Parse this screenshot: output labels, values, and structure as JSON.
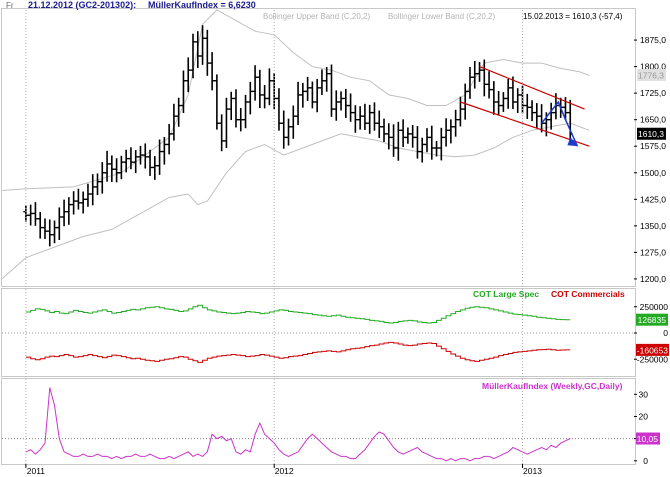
{
  "header": {
    "prefix": "Fr",
    "date_symbol": "21.12.2012 (GC2-201302):",
    "indicator": "MüllerKaufIndex = 6,6230",
    "band_upper": "Bollinger Upper Band (C,20,2)",
    "band_lower": "Bollinger Lower Band (C,20,2)",
    "last_quote": "15.02.2013 = 1610,3 (-57,4)"
  },
  "colors": {
    "bars": "#000000",
    "bands": "#c0c0c0",
    "channel": "#cc0000",
    "arrow": "#1a3ccc",
    "cot_large": "#22aa22",
    "cot_comm": "#cc0000",
    "kauf": "#cc33cc"
  },
  "chart_data": [
    {
      "type": "ohlc",
      "y_ticks": [
        "1875,0",
        "1800,0",
        "1725,0",
        "1650,0",
        "1575,0",
        "1500,0",
        "1425,0",
        "1350,0",
        "1275,0",
        "1200,0"
      ],
      "y_tick_values": [
        1875,
        1800,
        1725,
        1650,
        1575,
        1500,
        1425,
        1350,
        1275,
        1200
      ],
      "ylim": [
        1180,
        1960
      ],
      "price_labels": [
        {
          "text": "1776,3",
          "value": 1776.3
        },
        {
          "text": "1610,3",
          "value": 1610.3
        }
      ],
      "x_ticks": [
        "2011",
        "2012",
        "2013"
      ],
      "x_tick_weeks": [
        0,
        52,
        104
      ],
      "week_range": [
        -5,
        124
      ],
      "closes": [
        1380,
        1385,
        1370,
        1345,
        1335,
        1325,
        1345,
        1375,
        1390,
        1410,
        1420,
        1415,
        1425,
        1440,
        1460,
        1475,
        1500,
        1525,
        1510,
        1500,
        1530,
        1540,
        1530,
        1545,
        1550,
        1545,
        1515,
        1520,
        1560,
        1580,
        1610,
        1660,
        1690,
        1760,
        1790,
        1870,
        1830,
        1880,
        1810,
        1760,
        1640,
        1590,
        1680,
        1710,
        1650,
        1650,
        1700,
        1730,
        1770,
        1720,
        1710,
        1760,
        1710,
        1640,
        1600,
        1630,
        1660,
        1720,
        1730,
        1740,
        1700,
        1740,
        1760,
        1780,
        1680,
        1700,
        1710,
        1690,
        1670,
        1650,
        1660,
        1640,
        1670,
        1640,
        1630,
        1610,
        1600,
        1570,
        1620,
        1600,
        1610,
        1600,
        1560,
        1580,
        1600,
        1570,
        1570,
        1600,
        1620,
        1630,
        1650,
        1680,
        1730,
        1770,
        1780,
        1790,
        1750,
        1735,
        1700,
        1690,
        1710,
        1740,
        1700,
        1720,
        1690,
        1685,
        1670,
        1660,
        1640,
        1650,
        1670,
        1690,
        1685,
        1670,
        1610
      ],
      "upper_band": [
        [
          -5,
          1450
        ],
        [
          0,
          1455
        ],
        [
          10,
          1460
        ],
        [
          20,
          1500
        ],
        [
          26,
          1560
        ],
        [
          30,
          1600
        ],
        [
          34,
          1720
        ],
        [
          37,
          1920
        ],
        [
          40,
          1960
        ],
        [
          44,
          1930
        ],
        [
          48,
          1900
        ],
        [
          52,
          1890
        ],
        [
          56,
          1840
        ],
        [
          60,
          1800
        ],
        [
          64,
          1790
        ],
        [
          68,
          1770
        ],
        [
          72,
          1760
        ],
        [
          76,
          1720
        ],
        [
          80,
          1710
        ],
        [
          84,
          1690
        ],
        [
          88,
          1690
        ],
        [
          92,
          1720
        ],
        [
          96,
          1810
        ],
        [
          100,
          1820
        ],
        [
          104,
          1810
        ],
        [
          108,
          1810
        ],
        [
          112,
          1795
        ],
        [
          116,
          1785
        ],
        [
          118,
          1775
        ]
      ],
      "lower_band": [
        [
          -5,
          1200
        ],
        [
          0,
          1260
        ],
        [
          6,
          1290
        ],
        [
          12,
          1320
        ],
        [
          18,
          1340
        ],
        [
          22,
          1370
        ],
        [
          26,
          1400
        ],
        [
          30,
          1430
        ],
        [
          34,
          1440
        ],
        [
          36,
          1410
        ],
        [
          38,
          1420
        ],
        [
          42,
          1500
        ],
        [
          46,
          1560
        ],
        [
          50,
          1580
        ],
        [
          54,
          1550
        ],
        [
          58,
          1570
        ],
        [
          62,
          1590
        ],
        [
          66,
          1610
        ],
        [
          70,
          1600
        ],
        [
          74,
          1590
        ],
        [
          78,
          1570
        ],
        [
          82,
          1560
        ],
        [
          86,
          1550
        ],
        [
          90,
          1545
        ],
        [
          94,
          1550
        ],
        [
          98,
          1570
        ],
        [
          102,
          1600
        ],
        [
          106,
          1620
        ],
        [
          110,
          1630
        ],
        [
          114,
          1640
        ],
        [
          118,
          1620
        ]
      ],
      "channel_upper": [
        [
          95,
          1800
        ],
        [
          117,
          1680
        ]
      ],
      "channel_lower": [
        [
          91,
          1700
        ],
        [
          118,
          1575
        ]
      ]
    },
    {
      "type": "line",
      "legend": [
        "COT Large Spec",
        "COT Commercials"
      ],
      "y_ticks": [
        "250000",
        "0",
        "-250000"
      ],
      "y_tick_values": [
        250000,
        0,
        -250000
      ],
      "ylim": [
        -400000,
        400000
      ],
      "value_labels": [
        "126835",
        "-160653"
      ],
      "series": [
        {
          "name": "COT Large Spec",
          "values": [
            200000,
            215000,
            230000,
            225000,
            210000,
            195000,
            205000,
            190000,
            185000,
            200000,
            215000,
            205000,
            195000,
            190000,
            200000,
            210000,
            220000,
            205000,
            190000,
            195000,
            205000,
            215000,
            225000,
            220000,
            230000,
            240000,
            245000,
            250000,
            240000,
            230000,
            225000,
            215000,
            205000,
            210000,
            230000,
            250000,
            265000,
            240000,
            220000,
            210000,
            200000,
            195000,
            190000,
            185000,
            190000,
            195000,
            205000,
            200000,
            195000,
            185000,
            190000,
            200000,
            210000,
            220000,
            215000,
            205000,
            200000,
            195000,
            190000,
            185000,
            175000,
            170000,
            165000,
            160000,
            165000,
            170000,
            160000,
            150000,
            145000,
            140000,
            135000,
            130000,
            120000,
            115000,
            110000,
            100000,
            95000,
            100000,
            110000,
            115000,
            120000,
            115000,
            105000,
            100000,
            95000,
            100000,
            120000,
            140000,
            165000,
            185000,
            205000,
            220000,
            235000,
            245000,
            250000,
            245000,
            240000,
            230000,
            220000,
            210000,
            200000,
            190000,
            180000,
            175000,
            170000,
            165000,
            160000,
            150000,
            145000,
            140000,
            135000,
            130000,
            128000,
            127000,
            126835
          ]
        },
        {
          "name": "COT Commercials",
          "values": [
            -230000,
            -245000,
            -255000,
            -245000,
            -230000,
            -220000,
            -225000,
            -215000,
            -205000,
            -215000,
            -230000,
            -225000,
            -215000,
            -205000,
            -215000,
            -225000,
            -235000,
            -225000,
            -210000,
            -215000,
            -225000,
            -235000,
            -245000,
            -240000,
            -250000,
            -260000,
            -265000,
            -270000,
            -260000,
            -250000,
            -245000,
            -235000,
            -225000,
            -230000,
            -250000,
            -265000,
            -280000,
            -260000,
            -240000,
            -230000,
            -220000,
            -215000,
            -210000,
            -205000,
            -210000,
            -215000,
            -225000,
            -220000,
            -215000,
            -205000,
            -210000,
            -220000,
            -230000,
            -240000,
            -235000,
            -225000,
            -220000,
            -215000,
            -205000,
            -195000,
            -185000,
            -180000,
            -175000,
            -170000,
            -175000,
            -180000,
            -170000,
            -160000,
            -150000,
            -145000,
            -140000,
            -130000,
            -120000,
            -115000,
            -105000,
            -95000,
            -90000,
            -95000,
            -105000,
            -115000,
            -120000,
            -115000,
            -105000,
            -100000,
            -95000,
            -100000,
            -125000,
            -150000,
            -175000,
            -200000,
            -220000,
            -240000,
            -255000,
            -265000,
            -270000,
            -260000,
            -250000,
            -240000,
            -230000,
            -215000,
            -205000,
            -195000,
            -185000,
            -180000,
            -175000,
            -170000,
            -165000,
            -160000,
            -158000,
            -155000,
            -160000,
            -165000,
            -162000,
            -161000,
            -160653
          ]
        }
      ]
    },
    {
      "type": "line",
      "legend": [
        "MüllerKaufIndex (Weekly,GC,Daily)"
      ],
      "y_ticks": [
        "30",
        "20",
        "10",
        "0"
      ],
      "y_tick_values": [
        30,
        20,
        10,
        0
      ],
      "ylim": [
        -1,
        36
      ],
      "value_label": "10,05",
      "series": [
        {
          "name": "MüllerKaufIndex (Weekly,GC,Daily)",
          "values": [
            4,
            5,
            3,
            5,
            8,
            33,
            25,
            10,
            4,
            3,
            2,
            2,
            3,
            2,
            2,
            3,
            2,
            2,
            1,
            2,
            1,
            2,
            2,
            3,
            2,
            2,
            3,
            2,
            1,
            1,
            2,
            1,
            2,
            3,
            4,
            2,
            3,
            2,
            4,
            12,
            10,
            11,
            9,
            10,
            4,
            3,
            5,
            4,
            12,
            17,
            12,
            10,
            8,
            5,
            3,
            2,
            3,
            4,
            7,
            10,
            12,
            10,
            8,
            6,
            4,
            3,
            2,
            2,
            1,
            1,
            3,
            5,
            8,
            11,
            13,
            12,
            9,
            6,
            4,
            3,
            4,
            5,
            6,
            4,
            3,
            2,
            1,
            1,
            0,
            1,
            0,
            1,
            1,
            0,
            1,
            1,
            2,
            2,
            1,
            2,
            3,
            4,
            6,
            5,
            4,
            3,
            4,
            5,
            6,
            5,
            7,
            6,
            8,
            9,
            10.05
          ]
        }
      ]
    }
  ]
}
